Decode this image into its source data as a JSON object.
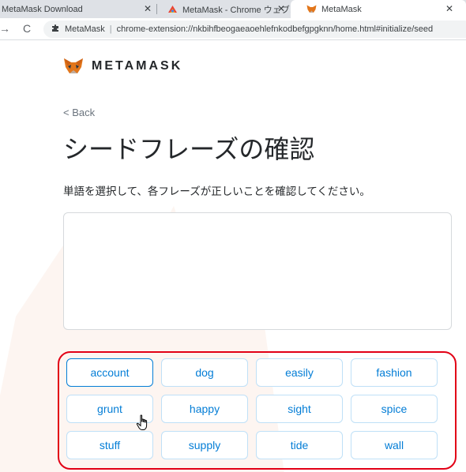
{
  "browser": {
    "tabs": [
      {
        "title": "MetaMask Download",
        "close": "✕"
      },
      {
        "title": "MetaMask - Chrome ウェブストア",
        "close": "✕"
      },
      {
        "title": "MetaMask",
        "close": "✕"
      }
    ],
    "nav": {
      "forward": "→",
      "reload": "C"
    },
    "omnibox": {
      "site": "MetaMask",
      "separator": "|",
      "url": "chrome-extension://nkbihfbeogaeaoehlefnkodbefgpgknn/home.html#initialize/seed"
    }
  },
  "page": {
    "brand": "METAMASK",
    "back": "< Back",
    "title": "シードフレーズの確認",
    "instruction": "単語を選択して、各フレーズが正しいことを確認してください。",
    "words": [
      "account",
      "dog",
      "easily",
      "fashion",
      "grunt",
      "happy",
      "sight",
      "spice",
      "stuff",
      "supply",
      "tide",
      "wall"
    ],
    "active_word": "account"
  },
  "colors": {
    "accent": "#037dd6",
    "word_border": "#bfe0f7",
    "highlight": "#e20016",
    "fox_orange": "#e2761b"
  }
}
